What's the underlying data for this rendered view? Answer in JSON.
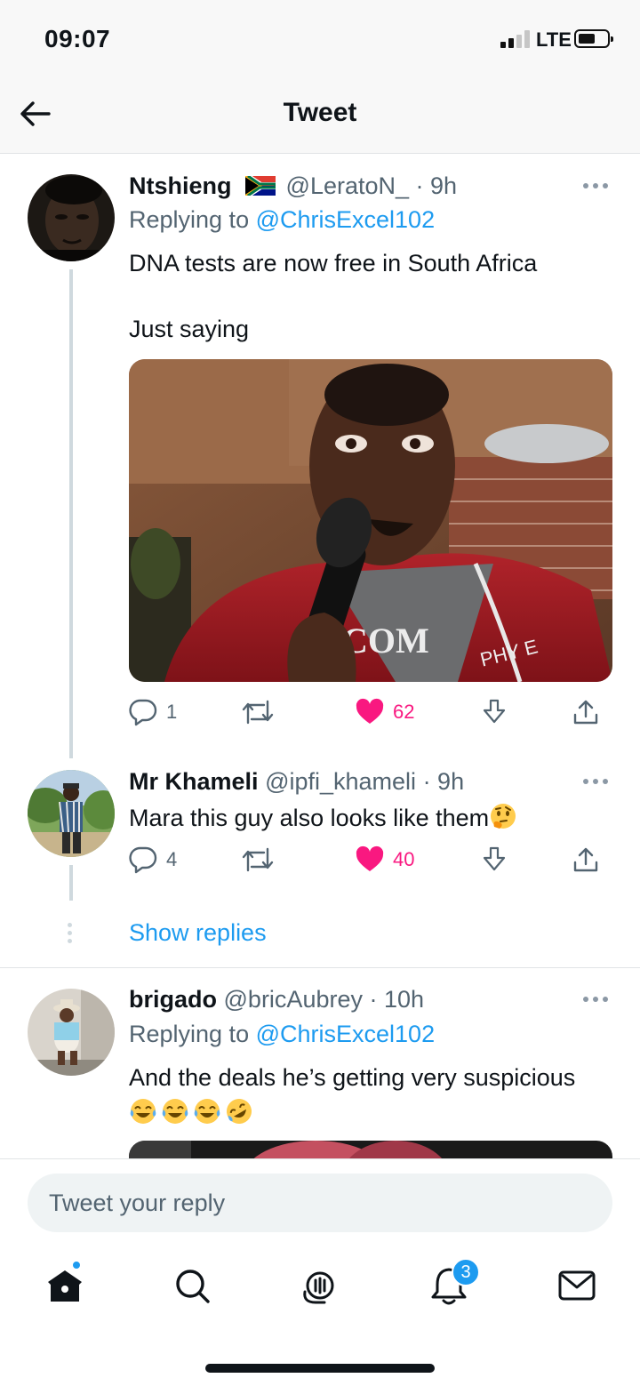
{
  "status_bar": {
    "time": "09:07",
    "network": "LTE"
  },
  "header": {
    "title": "Tweet",
    "back_icon": "arrow-left-icon"
  },
  "tweets": [
    {
      "name": "Ntshieng",
      "flag": "south-africa-flag",
      "handle": "@LeratoN_",
      "time": "· 9h",
      "replying_label": "Replying to",
      "replying_to": "@ChrisExcel102",
      "text_lines": [
        "DNA tests are now free in South Africa",
        "Just saying"
      ],
      "has_media": true,
      "replies": "1",
      "likes": "62",
      "liked": true
    },
    {
      "name": "Mr Khameli",
      "handle": "@ipfi_khameli",
      "time": "· 9h",
      "text_lines": [
        "Mara this guy also looks like them"
      ],
      "emoji": [
        "thinking-face"
      ],
      "replies": "4",
      "likes": "40",
      "liked": true
    },
    {
      "name": "brigado",
      "handle": "@bricAubrey",
      "time": "· 10h",
      "replying_label": "Replying to",
      "replying_to": "@ChrisExcel102",
      "text_lines": [
        "And the deals he’s getting very suspicious"
      ],
      "emoji": [
        "face-with-tears-of-joy",
        "face-with-tears-of-joy",
        "face-with-tears-of-joy",
        "rolling-on-the-floor-laughing"
      ]
    }
  ],
  "show_replies": "Show replies",
  "reply_box": {
    "placeholder": "Tweet your reply"
  },
  "tabbar": {
    "items": [
      "home-icon",
      "search-icon",
      "spaces-icon",
      "notifications-icon",
      "messages-icon"
    ],
    "notifications_badge": "3"
  },
  "colors": {
    "accent": "#1d9bf0",
    "like": "#f91880",
    "text": "#0f1419",
    "secondary": "#536471"
  }
}
